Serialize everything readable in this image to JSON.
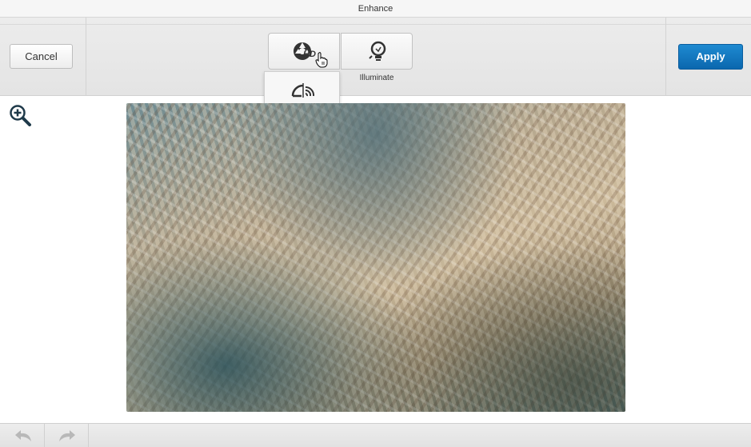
{
  "window": {
    "title": "Enhance"
  },
  "toolbar": {
    "cancel_label": "Cancel",
    "apply_label": "Apply",
    "tools": [
      {
        "name": "hd",
        "icon": "hd-aperture-icon",
        "label": ""
      },
      {
        "name": "illuminate",
        "icon": "lightbulb-icon",
        "label": "Illuminate"
      }
    ],
    "dropdown": {
      "icon": "dehaze-icon"
    }
  },
  "canvas": {
    "zoom_icon": "zoom-in-icon",
    "photo_description_icon": "aerial-city-photo"
  },
  "bottombar": {
    "undo_icon": "undo-icon",
    "redo_icon": "redo-icon"
  },
  "colors": {
    "apply": "#1478c0",
    "toolbar": "#e8e8e8"
  }
}
